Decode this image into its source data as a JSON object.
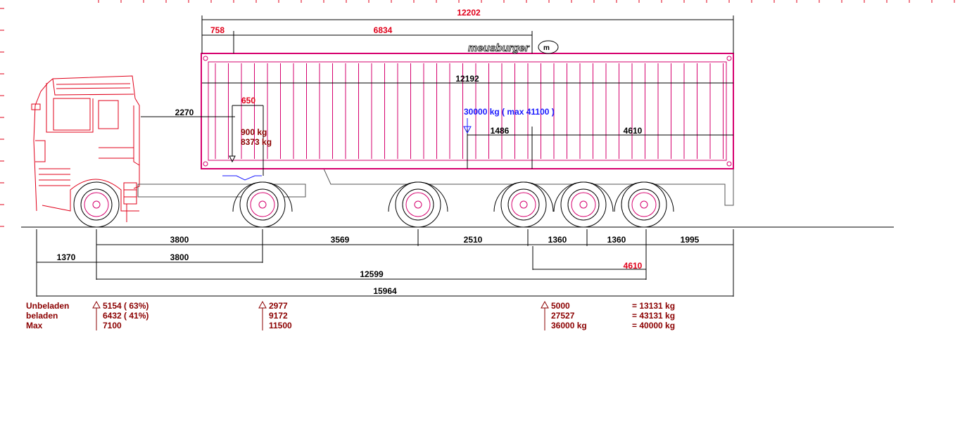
{
  "brand": {
    "logo_text": "meusburger"
  },
  "overall": {
    "total_length_top": "12202",
    "front_offset": "758",
    "container_offset": "6834",
    "container_length": "12192",
    "kingpin_height": "2270",
    "kingpin_offset": "650",
    "kingpin_load_empty": "900 kg",
    "kingpin_load_full": "8373 kg",
    "payload": "30000 kg ( max 41100 )",
    "cog_to_axle": "1486",
    "cog_rear": "4610"
  },
  "bottom_dims": {
    "row1": [
      "3800",
      "3569",
      "2510",
      "1360",
      "1360",
      "1995"
    ],
    "front_overhang": "1370",
    "wheelbase2": "3800",
    "axle_group_cog": "4610",
    "kingpin_to_axles": "12599",
    "total_length": "15964"
  },
  "weights": {
    "labels": [
      "Unbeladen",
      "beladen",
      "Max"
    ],
    "front_axle": [
      "5154 ( 63%)",
      "6432 ( 41%)",
      "7100"
    ],
    "drive_axle": [
      "2977",
      "9172",
      "11500"
    ],
    "trailer_axles": [
      "5000",
      "27527",
      "36000 kg"
    ],
    "totals": [
      "=   13131 kg",
      "=   43131 kg",
      "=   40000 kg"
    ]
  },
  "colors": {
    "outline": "#e0001a",
    "container": "#d6006e",
    "dimension": "#000000",
    "highlight_dim": "#e0001a",
    "load": "#1a1aff",
    "weights": "#8b0000"
  }
}
